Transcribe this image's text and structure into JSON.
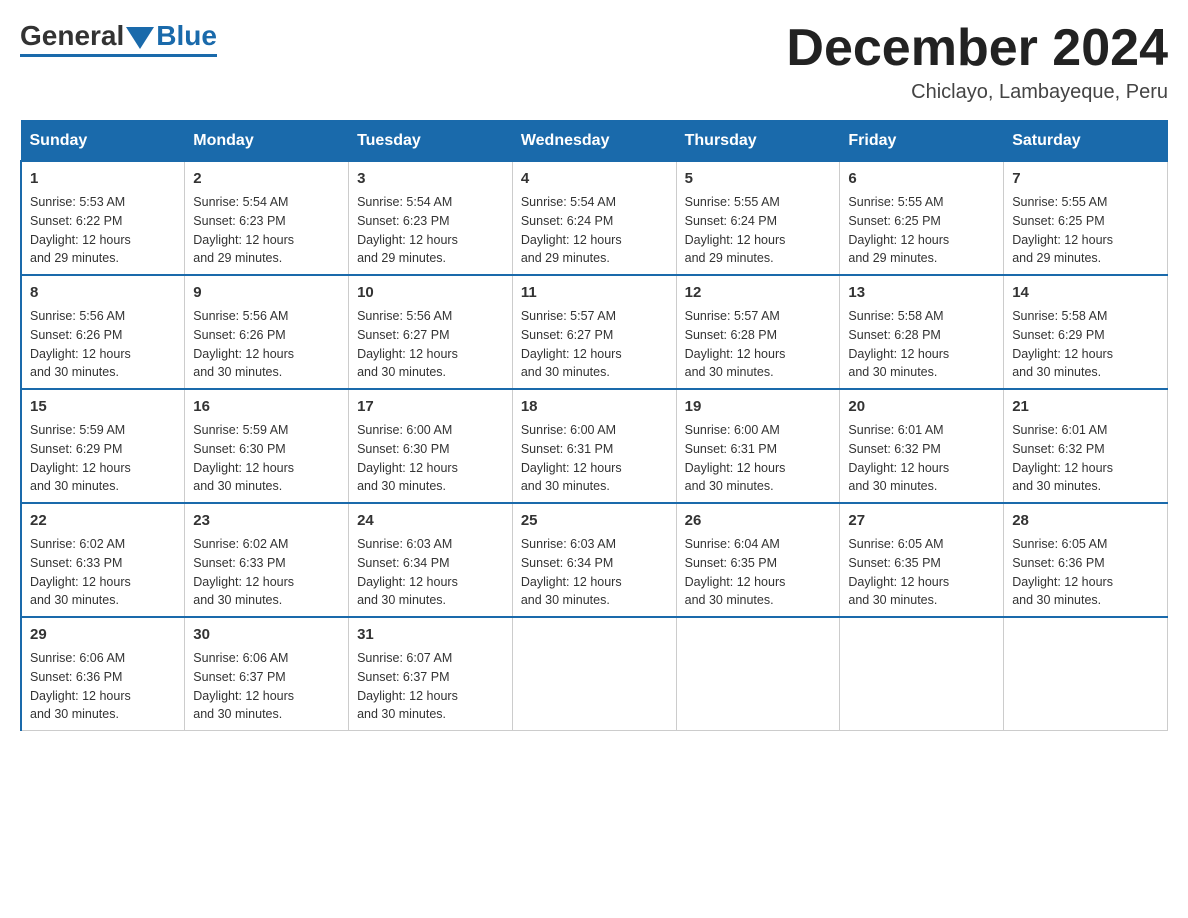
{
  "header": {
    "logo_general": "General",
    "logo_blue": "Blue",
    "month_title": "December 2024",
    "subtitle": "Chiclayo, Lambayeque, Peru"
  },
  "weekdays": [
    "Sunday",
    "Monday",
    "Tuesday",
    "Wednesday",
    "Thursday",
    "Friday",
    "Saturday"
  ],
  "weeks": [
    [
      {
        "day": "1",
        "sunrise": "5:53 AM",
        "sunset": "6:22 PM",
        "daylight": "12 hours and 29 minutes."
      },
      {
        "day": "2",
        "sunrise": "5:54 AM",
        "sunset": "6:23 PM",
        "daylight": "12 hours and 29 minutes."
      },
      {
        "day": "3",
        "sunrise": "5:54 AM",
        "sunset": "6:23 PM",
        "daylight": "12 hours and 29 minutes."
      },
      {
        "day": "4",
        "sunrise": "5:54 AM",
        "sunset": "6:24 PM",
        "daylight": "12 hours and 29 minutes."
      },
      {
        "day": "5",
        "sunrise": "5:55 AM",
        "sunset": "6:24 PM",
        "daylight": "12 hours and 29 minutes."
      },
      {
        "day": "6",
        "sunrise": "5:55 AM",
        "sunset": "6:25 PM",
        "daylight": "12 hours and 29 minutes."
      },
      {
        "day": "7",
        "sunrise": "5:55 AM",
        "sunset": "6:25 PM",
        "daylight": "12 hours and 29 minutes."
      }
    ],
    [
      {
        "day": "8",
        "sunrise": "5:56 AM",
        "sunset": "6:26 PM",
        "daylight": "12 hours and 30 minutes."
      },
      {
        "day": "9",
        "sunrise": "5:56 AM",
        "sunset": "6:26 PM",
        "daylight": "12 hours and 30 minutes."
      },
      {
        "day": "10",
        "sunrise": "5:56 AM",
        "sunset": "6:27 PM",
        "daylight": "12 hours and 30 minutes."
      },
      {
        "day": "11",
        "sunrise": "5:57 AM",
        "sunset": "6:27 PM",
        "daylight": "12 hours and 30 minutes."
      },
      {
        "day": "12",
        "sunrise": "5:57 AM",
        "sunset": "6:28 PM",
        "daylight": "12 hours and 30 minutes."
      },
      {
        "day": "13",
        "sunrise": "5:58 AM",
        "sunset": "6:28 PM",
        "daylight": "12 hours and 30 minutes."
      },
      {
        "day": "14",
        "sunrise": "5:58 AM",
        "sunset": "6:29 PM",
        "daylight": "12 hours and 30 minutes."
      }
    ],
    [
      {
        "day": "15",
        "sunrise": "5:59 AM",
        "sunset": "6:29 PM",
        "daylight": "12 hours and 30 minutes."
      },
      {
        "day": "16",
        "sunrise": "5:59 AM",
        "sunset": "6:30 PM",
        "daylight": "12 hours and 30 minutes."
      },
      {
        "day": "17",
        "sunrise": "6:00 AM",
        "sunset": "6:30 PM",
        "daylight": "12 hours and 30 minutes."
      },
      {
        "day": "18",
        "sunrise": "6:00 AM",
        "sunset": "6:31 PM",
        "daylight": "12 hours and 30 minutes."
      },
      {
        "day": "19",
        "sunrise": "6:00 AM",
        "sunset": "6:31 PM",
        "daylight": "12 hours and 30 minutes."
      },
      {
        "day": "20",
        "sunrise": "6:01 AM",
        "sunset": "6:32 PM",
        "daylight": "12 hours and 30 minutes."
      },
      {
        "day": "21",
        "sunrise": "6:01 AM",
        "sunset": "6:32 PM",
        "daylight": "12 hours and 30 minutes."
      }
    ],
    [
      {
        "day": "22",
        "sunrise": "6:02 AM",
        "sunset": "6:33 PM",
        "daylight": "12 hours and 30 minutes."
      },
      {
        "day": "23",
        "sunrise": "6:02 AM",
        "sunset": "6:33 PM",
        "daylight": "12 hours and 30 minutes."
      },
      {
        "day": "24",
        "sunrise": "6:03 AM",
        "sunset": "6:34 PM",
        "daylight": "12 hours and 30 minutes."
      },
      {
        "day": "25",
        "sunrise": "6:03 AM",
        "sunset": "6:34 PM",
        "daylight": "12 hours and 30 minutes."
      },
      {
        "day": "26",
        "sunrise": "6:04 AM",
        "sunset": "6:35 PM",
        "daylight": "12 hours and 30 minutes."
      },
      {
        "day": "27",
        "sunrise": "6:05 AM",
        "sunset": "6:35 PM",
        "daylight": "12 hours and 30 minutes."
      },
      {
        "day": "28",
        "sunrise": "6:05 AM",
        "sunset": "6:36 PM",
        "daylight": "12 hours and 30 minutes."
      }
    ],
    [
      {
        "day": "29",
        "sunrise": "6:06 AM",
        "sunset": "6:36 PM",
        "daylight": "12 hours and 30 minutes."
      },
      {
        "day": "30",
        "sunrise": "6:06 AM",
        "sunset": "6:37 PM",
        "daylight": "12 hours and 30 minutes."
      },
      {
        "day": "31",
        "sunrise": "6:07 AM",
        "sunset": "6:37 PM",
        "daylight": "12 hours and 30 minutes."
      },
      null,
      null,
      null,
      null
    ]
  ],
  "labels": {
    "sunrise": "Sunrise:",
    "sunset": "Sunset:",
    "daylight": "Daylight:"
  }
}
